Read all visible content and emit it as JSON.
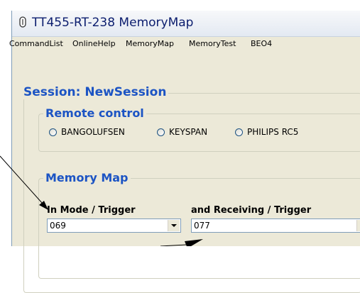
{
  "window": {
    "title": "TT455-RT-238 MemoryMap"
  },
  "menubar": {
    "items": [
      {
        "label": "CommandList"
      },
      {
        "label": "OnlineHelp"
      },
      {
        "label": "MemoryMap"
      },
      {
        "label": "MemoryTest"
      },
      {
        "label": "BEO4"
      }
    ]
  },
  "session": {
    "legend": "Session: NewSession"
  },
  "remote_control": {
    "legend": "Remote control",
    "options": [
      {
        "label": "BANGOLUFSEN",
        "selected": false
      },
      {
        "label": "KEYSPAN",
        "selected": false
      },
      {
        "label": "PHILIPS RC5",
        "selected": false
      }
    ]
  },
  "memory_map": {
    "legend": "Memory Map",
    "in_mode": {
      "label": "In Mode / Trigger",
      "value": "069"
    },
    "receiving": {
      "label": "and Receiving / Trigger",
      "value": "077"
    }
  },
  "colors": {
    "window_bg": "#ece9d8",
    "title_text": "#0b1d6e",
    "legend_text": "#1c54c4",
    "field_border": "#7f9db9"
  }
}
